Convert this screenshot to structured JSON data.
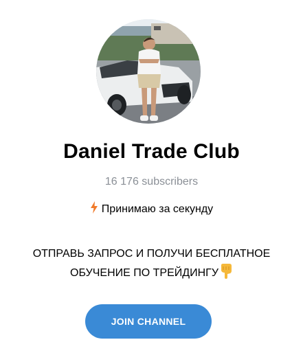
{
  "channel": {
    "title": "Daniel Trade Club",
    "subscribers": "16 176 subscribers",
    "tagline": "Принимаю за секунду",
    "tagline_icon": "lightning-icon",
    "promo_line_1": "ОТПРАВЬ ЗАПРОС И ПОЛУЧИ БЕСПЛАТНОЕ",
    "promo_line_2": "ОБУЧЕНИЕ ПО ТРЕЙДИНГУ",
    "promo_icon": "pointing-down-hand-icon"
  },
  "join_button": {
    "label": "JOIN CHANNEL",
    "color": "#3a8ad6"
  },
  "colors": {
    "subscribers_text": "#8a8f96",
    "background": "#ffffff"
  }
}
